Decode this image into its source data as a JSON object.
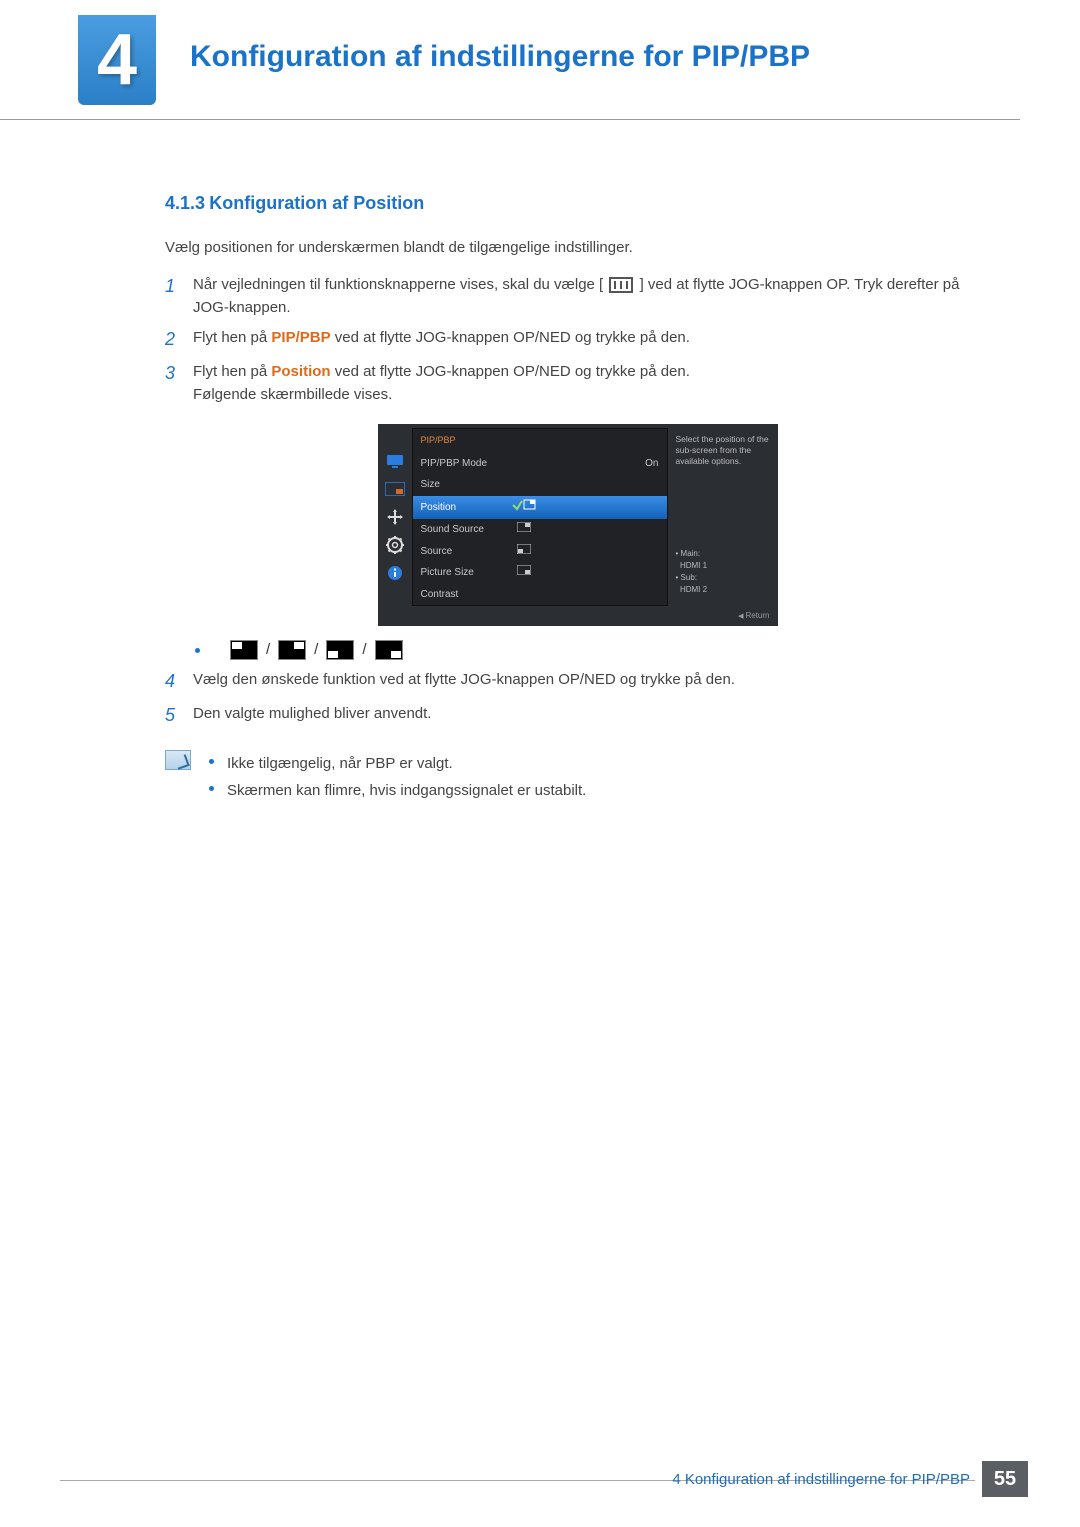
{
  "chapter": {
    "number": "4",
    "title": "Konfiguration af indstillingerne for PIP/PBP"
  },
  "section": {
    "number": "4.1.3",
    "title": "Konfiguration af Position"
  },
  "intro": "Vælg positionen for underskærmen blandt de tilgængelige indstillinger.",
  "steps": {
    "s1a": "Når vejledningen til funktionsknapperne vises, skal du vælge [",
    "s1b": "] ved at flytte JOG-knappen OP. Tryk derefter på JOG-knappen.",
    "s2a": "Flyt hen på ",
    "s2b": " ved at flytte JOG-knappen OP/NED og trykke på den.",
    "s2kw": "PIP/PBP",
    "s3a": "Flyt hen på ",
    "s3b": " ved at flytte JOG-knappen OP/NED og trykke på den.",
    "s3kw": "Position",
    "s3c": "Følgende skærmbillede vises.",
    "s4": "Vælg den ønskede funktion ved at flytte JOG-knappen OP/NED og trykke på den.",
    "s5": "Den valgte mulighed bliver anvendt."
  },
  "step_nums": {
    "n1": "1",
    "n2": "2",
    "n3": "3",
    "n4": "4",
    "n5": "5"
  },
  "osd": {
    "title": "PIP/PBP",
    "rows": {
      "mode": "PIP/PBP Mode",
      "mode_val": "On",
      "size": "Size",
      "position": "Position",
      "sound": "Sound Source",
      "source": "Source",
      "picsize": "Picture Size",
      "contrast": "Contrast"
    },
    "help": "Select the position of the sub-screen from the available options.",
    "status_main_label": "Main:",
    "status_main_val": "HDMI 1",
    "status_sub_label": "Sub:",
    "status_sub_val": "HDMI 2",
    "return": "Return"
  },
  "pos_sep": "/",
  "notes": {
    "n1": "Ikke tilgængelig, når PBP er valgt.",
    "n2": "Skærmen kan flimre, hvis indgangssignalet er ustabilt."
  },
  "footer": {
    "title": "4 Konfiguration af indstillingerne for PIP/PBP",
    "page": "55"
  }
}
